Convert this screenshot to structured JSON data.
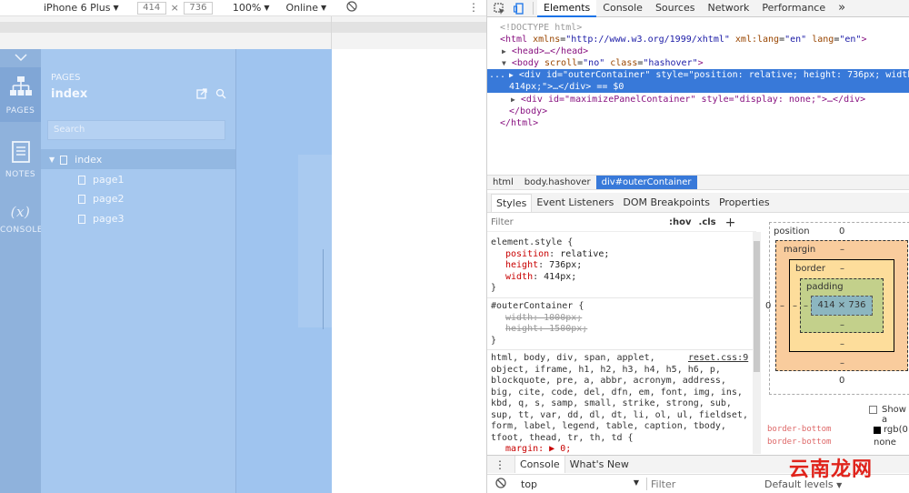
{
  "device_toolbar": {
    "device": "iPhone 6 Plus",
    "width": "414",
    "times": "×",
    "height": "736",
    "zoom": "100%",
    "network": "Online"
  },
  "prototype": {
    "rail": {
      "pages": "PAGES",
      "notes": "NOTES",
      "console_symbol": "(x)",
      "console": "CONSOLE"
    },
    "pages_panel": {
      "header": "PAGES",
      "title": "index",
      "search_placeholder": "Search",
      "tree": [
        "index",
        "page1",
        "page2",
        "page3"
      ]
    }
  },
  "devtools": {
    "tabs": [
      "Elements",
      "Console",
      "Sources",
      "Network",
      "Performance"
    ],
    "more": "»",
    "dom": {
      "doctype": "<!DOCTYPE html>",
      "html_open_tag": "<html",
      "html_attr1_name": " xmlns",
      "html_attr1_value": "\"http://www.w3.org/1999/xhtml\"",
      "html_attr2_name": " xml:lang",
      "html_attr2_value": "\"en\"",
      "html_attr3_name": " lang",
      "html_attr3_value": "\"en\"",
      "gt": ">",
      "head_line": "<head>…</head>",
      "body_open": "<body",
      "body_scroll_name": " scroll",
      "body_scroll_value": "\"no\"",
      "body_class_name": " class",
      "body_class_value": "\"hashover\"",
      "div_sel_line1": "<div id=\"outerContainer\" style=\"position: relative; height: 736px; width:",
      "div_sel_line2": "414px;\">…</div> == $0",
      "div2": "<div id=\"maximizePanelContainer\" style=\"display: none;\">…</div>",
      "body_close": "</body>",
      "html_close": "</html>",
      "ellipsis": "..."
    },
    "breadcrumbs": [
      "html",
      "body.hashover",
      "div#outerContainer"
    ],
    "subtabs": [
      "Styles",
      "Event Listeners",
      "DOM Breakpoints",
      "Properties"
    ],
    "styles": {
      "filter": "Filter",
      "hov": ":hov",
      "cls": ".cls",
      "plus": "+",
      "element_style": "element.style {",
      "prop1_name": "position",
      "prop1_value": "relative;",
      "prop2_name": "height",
      "prop2_value": "736px;",
      "prop3_name": "width",
      "prop3_value": "414px;",
      "close": "}",
      "outer_selector": "#outerContainer {",
      "outer_prop1": "width: 1000px;",
      "outer_prop2": "height: 1500px;",
      "reset_selector_lines": [
        "html, body, div, span, applet,",
        "object, iframe, h1, h2, h3, h4, h5, h6, p,",
        "blockquote, pre, a, abbr, acronym, address,",
        "big, cite, code, del, dfn, em, font, img, ins,",
        "kbd, q, s, samp, small, strike, strong, sub,",
        "sup, tt, var, dd, dl, dt, li, ol, ul, fieldset,",
        "form, label, legend, table, caption, tbody,",
        "tfoot, thead, tr, th, td {"
      ],
      "reset_source": "reset.css:9",
      "reset_prop": "margin: ▶ 0;"
    },
    "box_model": {
      "position_label": "position",
      "position_value": "0",
      "margin_label": "margin",
      "border_label": "border",
      "padding_label": "padding",
      "content": "414 × 736",
      "dash": "–",
      "zero": "0",
      "show_all": "Show a",
      "rgb": "rgb(0",
      "none": "none",
      "border_prop1": "border-bottom",
      "border_prop2": "border-bottom"
    },
    "bottom_tabs": [
      "Console",
      "What's New"
    ],
    "console_bar": {
      "context": "top",
      "filter": "Filter",
      "levels": "Default levels"
    }
  },
  "colors": {
    "viewport": "#9fc4ef",
    "selection": "#3879d9",
    "margin": "#f9cc9d",
    "border": "#fddd9b",
    "padding": "#c3d08b",
    "content": "#8cb6c0"
  },
  "watermark": "云南龙网"
}
